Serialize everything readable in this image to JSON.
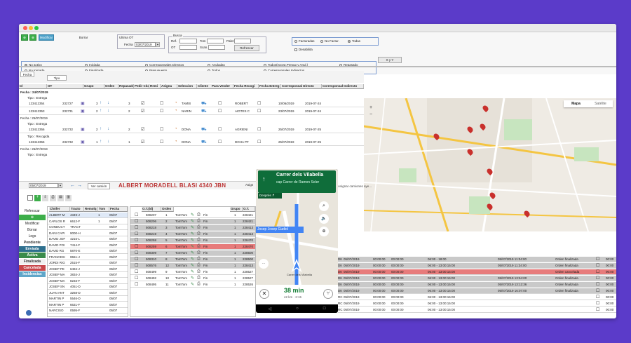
{
  "toolbar": {
    "modify_label": "Modificar",
    "delete_label": "Borrar",
    "last_ot_label": "Ultima OT",
    "date_label": "Fecha",
    "date_value": "03/07/2019",
    "search_legend": "Busca",
    "ref_label": "Ref.",
    "tom_label": "Tom",
    "palet_label": "Palet",
    "ot_label": "OT",
    "scan_label": "Scan.",
    "refresh_label": "Refrescar",
    "facturadas_label": "Facturadas",
    "no_factur_label": "No Factur.",
    "todas_label": "Todas",
    "desabilita_label": "Desabilita",
    "xy_label": "X y Y"
  },
  "filters": [
    {
      "label": "No activo",
      "checked": true
    },
    {
      "label": "Iniciada",
      "checked": false
    },
    {
      "label": "Corresponsales Directos",
      "checked": false
    },
    {
      "label": "Anuladas",
      "checked": false
    },
    {
      "label": "Todos(excep.Presup y Anul.)",
      "checked": false
    },
    {
      "label": "Repasado",
      "checked": false
    },
    {
      "label": "No Iniciada",
      "checked": false
    },
    {
      "label": "Finalizada",
      "checked": false
    },
    {
      "label": "Presupuesto",
      "checked": false
    },
    {
      "label": "Todos",
      "checked": false
    },
    {
      "label": "Corresponsales Indirectos",
      "checked": false
    }
  ],
  "grouping": {
    "fecha_chip": "Fecha",
    "tipo_chip": "Tipo"
  },
  "top_grid": {
    "headers": [
      "Id",
      "OT",
      "Grupo",
      "Orden",
      "Repasado",
      "Pedir Cita",
      "Remi",
      "Asigna",
      "Seleccion",
      "Cliente",
      "Para Vender",
      "Fecha Recogi",
      "Fecha Entreg",
      "Corresponsal Directo",
      "Corresponsal Indirecto",
      "Dirección",
      "Ciudad",
      "CP",
      "Trazr. C.",
      "Recoger"
    ],
    "groups": [
      {
        "fecha": "Fecha : 24/07/2019",
        "tipo": "Tipo : Entrega",
        "rows": [
          {
            "id": "123412354",
            "ot": "232727",
            "grupo": "3",
            "orden": "3",
            "remi": "TAMIS",
            "cliente": "ROBERT",
            "recogida": "10/06/2019",
            "entrega": "2019-07-24"
          },
          {
            "id": "123412353",
            "ot": "232731",
            "grupo": "2",
            "orden": "2",
            "remi": "NARIN",
            "cliente": "AIGTES C",
            "recogida": "23/07/2019",
            "entrega": "2019-07-24"
          }
        ]
      },
      {
        "fecha": "Fecha : 25/07/2019",
        "tipo": "Tipo : Entrega",
        "rows": [
          {
            "id": "123412356",
            "ot": "232732",
            "grupo": "2",
            "orden": "2",
            "remi": "DONA",
            "cliente": "AGRIENI",
            "recogida": "25/07/2019",
            "entrega": "2019-07-25"
          }
        ]
      },
      {
        "fecha": "",
        "tipo": "Tipo : Recogida",
        "rows": [
          {
            "id": "123412355",
            "ot": "232732",
            "grupo": "1",
            "orden": "1",
            "remi": "DONA",
            "cliente": "DOHA PF",
            "recogida": "25/07/2019",
            "entrega": "2019-07-25"
          }
        ]
      },
      {
        "fecha": "Fecha : 26/07/2019",
        "tipo": "Tipo : Entrega",
        "rows": []
      }
    ]
  },
  "mid_bar": {
    "date_value": "05/07/2019",
    "view_truck_label": "Ver camión",
    "driver_name": "ALBERT MORADELL BLASI 4340 JBN",
    "assign_label": "Asign",
    "assign_trucks_label": "Asignar camiones aye..."
  },
  "side_menu": {
    "refresh": "Refrescar",
    "modify": "Modificar",
    "delete": "Borrar",
    "logs": "Logs",
    "states": [
      {
        "label": "Pendiente",
        "color": "#ffffff",
        "text": "#333333"
      },
      {
        "label": "Enviada",
        "color": "#2e6f8e",
        "text": "#ffffff"
      },
      {
        "label": "Activa",
        "color": "#3a8b4b",
        "text": "#ffffff"
      },
      {
        "label": "Finalizada",
        "color": "#f0f0f0",
        "text": "#333333"
      },
      {
        "label": "Cancelada",
        "color": "#c8474b",
        "text": "#ffffff"
      },
      {
        "label": "Incidencias",
        "color": "#5fa6c9",
        "text": "#ffffff"
      }
    ]
  },
  "drivers": {
    "headers": [
      "Chófer",
      "Tracto",
      "Remolq",
      "Tom",
      "Fecha"
    ],
    "rows": [
      [
        "ALBERT M",
        "4349-J",
        "",
        "1",
        "05/07"
      ],
      [
        "CARLOS R",
        "6612-F",
        "",
        "1",
        "05/07"
      ],
      [
        "CONDUCT",
        "TRACT",
        "",
        "",
        "05/07"
      ],
      [
        "DANI CAPI",
        "9000-H",
        "",
        "",
        "05/07"
      ],
      [
        "DAVID JOF",
        "4215-L",
        "",
        "",
        "05/07"
      ],
      [
        "DAVID POI",
        "7414-F",
        "",
        "",
        "05/07"
      ],
      [
        "DAVID RG",
        "5870-E",
        "",
        "",
        "05/07"
      ],
      [
        "FRANCESI",
        "9551-J",
        "",
        "",
        "05/07"
      ],
      [
        "JORDI RIG",
        "2515-F",
        "",
        "",
        "05/07"
      ],
      [
        "JOSEP PE",
        "6494-J",
        "",
        "",
        "05/07"
      ],
      [
        "JOSEP MA",
        "3834-J",
        "",
        "",
        "05/07"
      ],
      [
        "JOSEP MA",
        "8233-F",
        "",
        "",
        "05/07"
      ],
      [
        "JOSEP SN",
        "4051-D",
        "",
        "",
        "05/07"
      ],
      [
        "JUAN ANT",
        "3268-D",
        "",
        "",
        "05/07"
      ],
      [
        "MARTIN P",
        "5546-D",
        "",
        "",
        "05/07"
      ],
      [
        "MARTIN P",
        "6631-F",
        "",
        "",
        "05/07"
      ],
      [
        "NARCISO",
        "0595-F",
        "",
        "",
        "05/07"
      ]
    ]
  },
  "orders": {
    "headers": [
      "O.T.(id)",
      "Orden",
      "",
      "",
      "",
      "Grupo",
      "O.T.",
      "Id Ge"
    ],
    "rows": [
      {
        "id": "508207",
        "orden": "1",
        "tom": "TomTom",
        "fin": "Fin",
        "grupo": "1",
        "ot": "228421",
        "idg": "9",
        "state": "normal"
      },
      {
        "id": "508206",
        "orden": "2",
        "tom": "TomTom",
        "fin": "Fin",
        "grupo": "1",
        "ot": "228421",
        "idg": "9",
        "state": "grey"
      },
      {
        "id": "508218",
        "orden": "3",
        "tom": "TomTom",
        "fin": "Fin",
        "grupo": "1",
        "ot": "228413",
        "idg": "9",
        "state": "grey"
      },
      {
        "id": "508219",
        "orden": "4",
        "tom": "TomTom",
        "fin": "Fin",
        "grupo": "1",
        "ot": "228413",
        "idg": "9",
        "state": "grey"
      },
      {
        "id": "508258",
        "orden": "5",
        "tom": "TomTom",
        "fin": "Fin",
        "grupo": "1",
        "ot": "228470",
        "idg": "9",
        "state": "grey"
      },
      {
        "id": "508259",
        "orden": "6",
        "tom": "TomTom",
        "fin": "Fin",
        "grupo": "1",
        "ot": "228470",
        "idg": "9",
        "state": "red"
      },
      {
        "id": "508309",
        "orden": "7",
        "tom": "TomTom",
        "fin": "Fin",
        "grupo": "1",
        "ot": "228500",
        "idg": "9",
        "state": "grey"
      },
      {
        "id": "508310",
        "orden": "8",
        "tom": "TomTom",
        "fin": "Fin",
        "grupo": "1",
        "ot": "228500",
        "idg": "9",
        "state": "grey"
      },
      {
        "id": "508576",
        "orden": "12",
        "tom": "TomTom",
        "fin": "Fin",
        "grupo": "1",
        "ot": "228413",
        "idg": "9",
        "state": "grey"
      },
      {
        "id": "508499",
        "orden": "9",
        "tom": "TomTom",
        "fin": "Fin",
        "grupo": "1",
        "ot": "228527",
        "idg": "9",
        "state": "normal"
      },
      {
        "id": "508492",
        "orden": "10",
        "tom": "TomTom",
        "fin": "Fin",
        "grupo": "1",
        "ot": "228527",
        "idg": "9",
        "state": "normal"
      },
      {
        "id": "508495",
        "orden": "11",
        "tom": "TomTom",
        "fin": "Fin",
        "grupo": "1",
        "ot": "228526",
        "idg": "9",
        "state": "normal"
      }
    ]
  },
  "right_rows": [
    {
      "c1": "DK",
      "c2": "05/07/2019",
      "c3": "00:00:00",
      "c4": "00:00:00",
      "c5": "06:00 - 18:00",
      "c6": "05/07/2019 11:04:00",
      "c7": "Orden finalizada",
      "c8": "00:00"
    },
    {
      "c1": "DK",
      "c2": "05/07/2019",
      "c3": "00:00:00",
      "c4": "00:00:00",
      "c5": "06:00 - 13:00:15:00",
      "c6": "05/07/2019 11:34:00",
      "c7": "Orden finalizada",
      "c8": "00:00"
    },
    {
      "c1": "DK",
      "c2": "05/07/2019",
      "c3": "00:00:00",
      "c4": "00:00:00",
      "c5": "06:00 - 13:00:15:00",
      "c6": "",
      "c7": "Orden cancelada",
      "c8": "00:00"
    },
    {
      "c1": "DK",
      "c2": "05/07/2019",
      "c3": "00:00:00",
      "c4": "00:00:00",
      "c5": "06:00 - 13:00:15:00",
      "c6": "05/07/2019 13:54:00",
      "c7": "Orden finalizada",
      "c8": "00:00"
    },
    {
      "c1": "DK",
      "c2": "05/07/2019",
      "c3": "00:00:00",
      "c4": "00:00:00",
      "c5": "06:00 - 13:00:15:00",
      "c6": "05/07/2019 13:12:36",
      "c7": "Orden finalizada",
      "c8": "00:00"
    },
    {
      "c1": "DK",
      "c2": "05/07/2019",
      "c3": "00:00:00",
      "c4": "00:00:00",
      "c5": "06:00 - 13:00:15:00",
      "c6": "05/07/2019 16:07:00",
      "c7": "Orden finalizada",
      "c8": "00:00"
    },
    {
      "c1": "RC",
      "c2": "05/07/2019",
      "c3": "00:00:00",
      "c4": "00:00:00",
      "c5": "06:00 - 13:00:15:00",
      "c6": "",
      "c7": "",
      "c8": "00:00"
    },
    {
      "c1": "RC",
      "c2": "05/07/2019",
      "c3": "00:00:00",
      "c4": "00:00:00",
      "c5": "06:00 - 13:00:15:00",
      "c6": "",
      "c7": "",
      "c8": "00:00"
    },
    {
      "c1": "RC",
      "c2": "05/07/2019",
      "c3": "00:00:00",
      "c4": "00:00:00",
      "c5": "06:00 - 13:00:15:00",
      "c6": "",
      "c7": "",
      "c8": "00:00"
    }
  ],
  "map": {
    "map_label": "Mapa",
    "sat_label": "Satélite"
  },
  "phone": {
    "street": "Carrer dels Vilabella",
    "via": "cap Carrer de Ramon Soler",
    "then_label": "Després ↱",
    "road_label": "Josep Josep Gudiol",
    "dest_label": "Carrer dels Vilabella",
    "eta": "38 min",
    "distance": "42 km · 2:15"
  },
  "colors": {
    "accent": "#5b3bc9",
    "green": "#3cae49",
    "blue_btn": "#4aa0c8",
    "row_red": "#e77b7b",
    "row_grey": "#c9c9c9"
  }
}
